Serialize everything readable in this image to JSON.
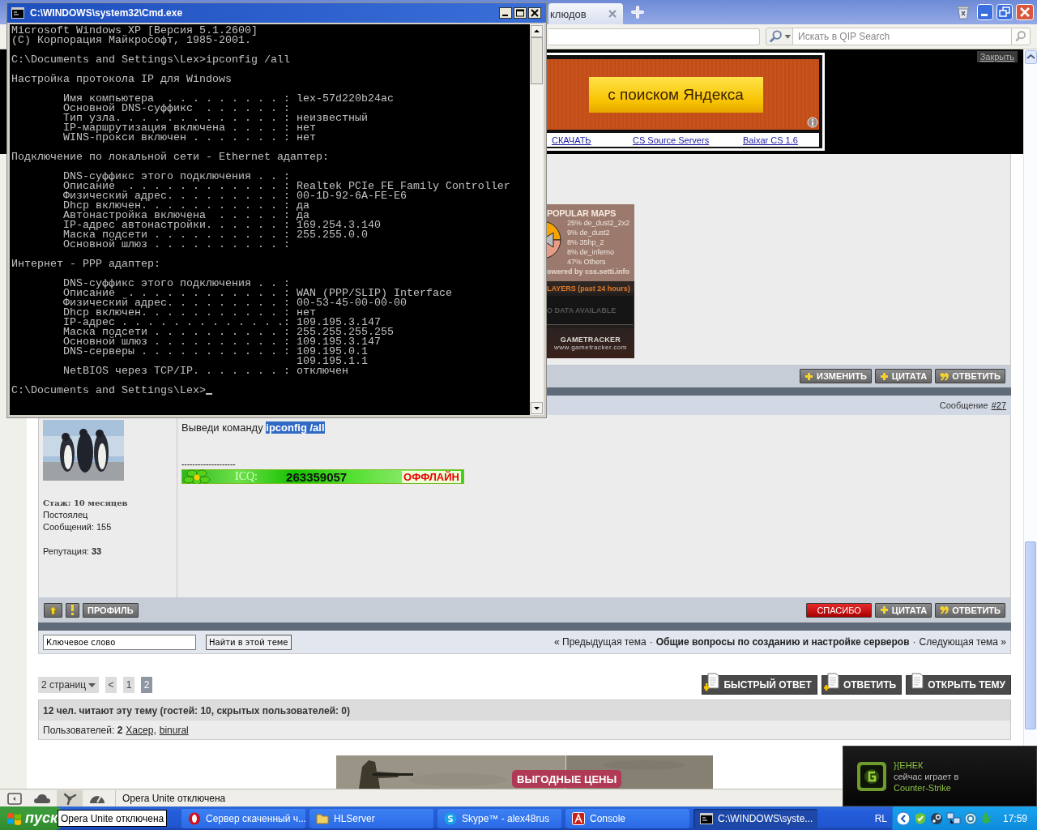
{
  "browser": {
    "tab": {
      "label": "клюдов",
      "selected": true
    },
    "search_field": {
      "placeholder": "Искать в QIP Search"
    },
    "ad_banner": {
      "button": "с поиском Яндекса",
      "links": [
        "СКАЧАТЬ",
        "CS Source Servers",
        "Baixar CS 1.6"
      ],
      "close": "Закрыть"
    },
    "maps_widget": {
      "title": "POPULAR MAPS",
      "legend": [
        "25% de_dust2_2x2",
        "9% de_dust2",
        "8% 35hp_2",
        "8% de_inferno",
        "47% Others"
      ],
      "powered": "owered by css.setti.info",
      "players_title": "LAYERS (past 24 hours)",
      "players_note": "O DATA AVAILABLE",
      "brand": "GAMETRACKER",
      "url": "www.gametracker.com"
    },
    "post_1": {
      "buttons": [
        {
          "kind": "plus",
          "label": "ИЗМЕНИТЬ"
        },
        {
          "kind": "plus",
          "label": "ЦИТАТА"
        },
        {
          "kind": "quote",
          "label": "ОТВЕТИТЬ"
        }
      ]
    },
    "post_2": {
      "header_label": "Сообщение",
      "number": "#27",
      "author": {
        "experience": "Стаж: 10 месяцев",
        "rank": "Постоялец",
        "posts": "Сообщений: 155",
        "reputation": "Репутация: **33**"
      },
      "message": "Выведи команду **ipconfig /all**",
      "signature": {
        "rule": "--------------------",
        "icq_label": "ICQ:",
        "icq_number": "263359057",
        "icq_status": "ОФФЛАЙН"
      },
      "left_buttons": [
        {
          "kind": "up"
        },
        {
          "kind": "report"
        },
        {
          "kind": "text",
          "label": "ПРОФИЛЬ"
        }
      ],
      "right_buttons": [
        {
          "kind": "thanks",
          "label": "СПАСИБО"
        },
        {
          "kind": "plus",
          "label": "ЦИТАТА"
        },
        {
          "kind": "quote",
          "label": "ОТВЕТИТЬ"
        }
      ]
    },
    "search_row": {
      "field": {
        "value": "Ключевое слово"
      },
      "button": "Найти в этой теме",
      "nav": {
        "prev": "« Предыдущая тема",
        "separator_1": "·",
        "topic": "Общие вопросы по созданию и настройке серверов",
        "separator_2": "·",
        "next": "Следующая тема »"
      }
    },
    "pagination": {
      "pages_menu": "2 страниц",
      "items": [
        {
          "label": "<",
          "selected": false
        },
        {
          "label": "1",
          "selected": false
        },
        {
          "label": "2",
          "selected": true
        }
      ]
    },
    "actions": [
      {
        "kind": "quick",
        "label": "БЫСТРЫЙ ОТВЕТ"
      },
      {
        "kind": "reply",
        "label": "ОТВЕТИТЬ"
      },
      {
        "kind": "new",
        "label": "ОТКРЫТЬ ТЕМУ"
      }
    ],
    "viewers": {
      "summary": "12 чел. читают эту тему (гостей: 10, скрытых пользователей: 0)",
      "users_label": "Пользователей: **2**",
      "users": [
        "Хасер,",
        "binural"
      ]
    },
    "bottom_ad": {
      "badge": "ВЫГОДНЫЕ ЦЕНЫ"
    },
    "status_bar": {
      "icons": [
        {
          "kind": "panel",
          "highlighted": false
        },
        {
          "kind": "cloud",
          "highlighted": false
        },
        {
          "kind": "unite",
          "highlighted": true
        },
        {
          "kind": "speed",
          "highlighted": false
        }
      ],
      "text": "Opera Unite отключена"
    }
  },
  "console": {
    "title": "C:\\WINDOWS\\system32\\Cmd.exe",
    "cursor": true,
    "paragraphs": [
      [
        "Microsoft Windows XP [Версия 5.1.2600]",
        "(С) Корпорация Майкрософт, 1985-2001."
      ],
      [
        "C:\\Documents and Settings\\Lex>ipconfig /all"
      ],
      [
        "Настройка протокола IP для Windows"
      ],
      [
        "        Имя компьютера  . . . . . . . . . : lex-57d220b24ac",
        "        Основной DNS-суффикс  . . . . . . :",
        "        Тип узла. . . . . . . . . . . . . : неизвестный",
        "        IP-маршрутизация включена . . . . : нет",
        "        WINS-прокси включен . . . . . . . : нет"
      ],
      [
        "Подключение по локальной сети - Ethernet адаптер:"
      ],
      [
        "        DNS-суффикс этого подключения . . :",
        "        Описание  . . . . . . . . . . . . : Realtek PCIe FE Family Controller",
        "        Физический адрес. . . . . . . . . : 00-1D-92-6A-FE-E6",
        "        Dhcp включен. . . . . . . . . . . : да",
        "        Автонастройка включена  . . . . . : да",
        "        IP-адрес автонастройки. . . . . . : 169.254.3.140",
        "        Маска подсети . . . . . . . . . . : 255.255.0.0",
        "        Основной шлюз . . . . . . . . . . :"
      ],
      [
        "Интернет - PPP адаптер:"
      ],
      [
        "        DNS-суффикс этого подключения . . :",
        "        Описание  . . . . . . . . . . . . : WAN (PPP/SLIP) Interface",
        "        Физический адрес. . . . . . . . . : 00-53-45-00-00-00",
        "        Dhcp включен. . . . . . . . . . . : нет",
        "        IP-адрес . . . . . . . . . . . . .: 109.195.3.147",
        "        Маска подсети . . . . . . . . . . : 255.255.255.255",
        "        Основной шлюз . . . . . . . . . . : 109.195.3.147",
        "        DNS-серверы . . . . . . . . . . . : 109.195.0.1",
        "                                            109.195.1.1",
        "        NetBIOS через TCP/IP. . . . . . . : отключен"
      ],
      [
        "C:\\Documents and Settings\\Lex>"
      ]
    ]
  },
  "notification": {
    "player": "}{ЕНЕК",
    "text": "сейчас играет в",
    "game": "Counter-Strike"
  },
  "taskbar": {
    "start": "пуск",
    "tooltip": "Opera Unite отключена",
    "buttons": [
      {
        "kind": "opera",
        "label": "Сервер скаченный ч...",
        "active": false
      },
      {
        "kind": "folder",
        "label": "HLServer",
        "active": false
      },
      {
        "kind": "skype",
        "label": "Skype™ - alex48rus",
        "active": false
      },
      {
        "kind": "app",
        "label": "Console",
        "active": false
      },
      {
        "kind": "console",
        "label": "C:\\WINDOWS\\syste...",
        "active": true
      }
    ],
    "tray": {
      "language": "RL",
      "clock": "17:59"
    }
  }
}
